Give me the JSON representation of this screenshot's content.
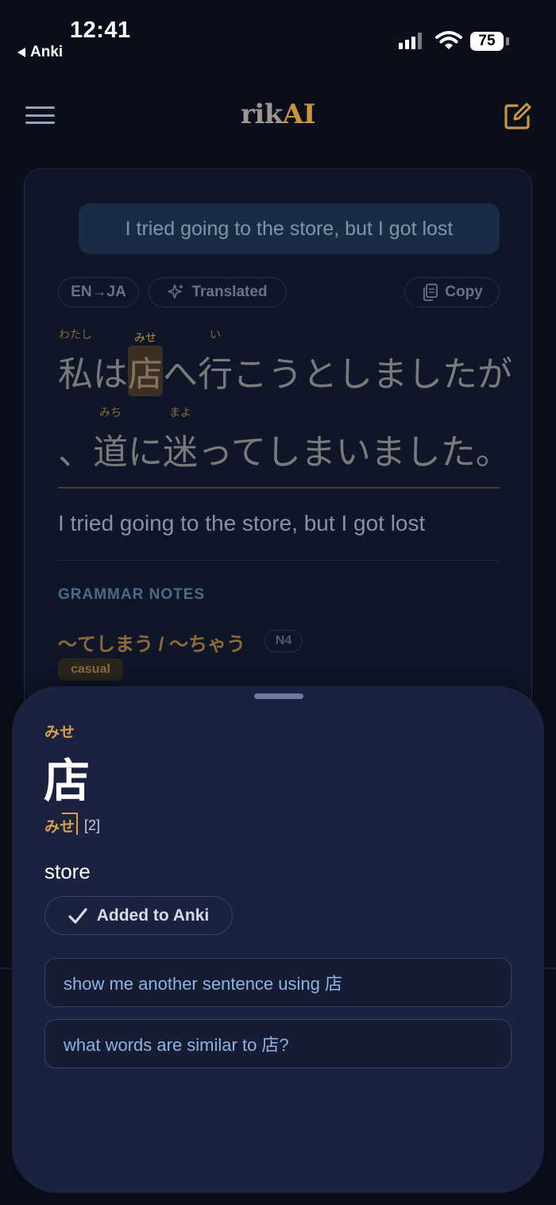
{
  "status_bar": {
    "time": "12:41",
    "back_app": "Anki",
    "battery": "75"
  },
  "header": {
    "brand_part1": "rik",
    "brand_part2": "AI",
    "menu_icon": "hamburger-icon",
    "edit_icon": "compose-icon",
    "accent_color": "#c9963f"
  },
  "card": {
    "input_text": "I tried going to the store, but I got lost",
    "direction_label": "EN→JA",
    "status_label": "Translated",
    "copy_label": "Copy",
    "japanese": {
      "line1": [
        {
          "text": "私",
          "reading": "わたし"
        },
        {
          "text": "は",
          "reading": ""
        },
        {
          "text": "店",
          "reading": "みせ",
          "highlight": true
        },
        {
          "text": "へ",
          "reading": ""
        },
        {
          "text": "行",
          "reading": "い"
        },
        {
          "text": "こうとしましたが",
          "reading": ""
        }
      ],
      "line2": [
        {
          "text": "、",
          "reading": ""
        },
        {
          "text": "道",
          "reading": "みち"
        },
        {
          "text": "に",
          "reading": ""
        },
        {
          "text": "迷",
          "reading": "まよ"
        },
        {
          "text": "ってしまいました。",
          "reading": ""
        }
      ]
    },
    "translation": "I tried going to the store, but I got lost",
    "grammar_heading": "GRAMMAR NOTES",
    "grammar_title": "〜てしまう / 〜ちゃう",
    "grammar_level": "N4",
    "grammar_tag": "casual"
  },
  "sheet": {
    "reading": "みせ",
    "kanji": "店",
    "pitch_kana": "みせ",
    "pitch_number": "[2]",
    "meaning": "store",
    "added_label": "Added to Anki",
    "suggestions": [
      "show me another sentence using 店",
      "what words are similar to 店?"
    ]
  }
}
